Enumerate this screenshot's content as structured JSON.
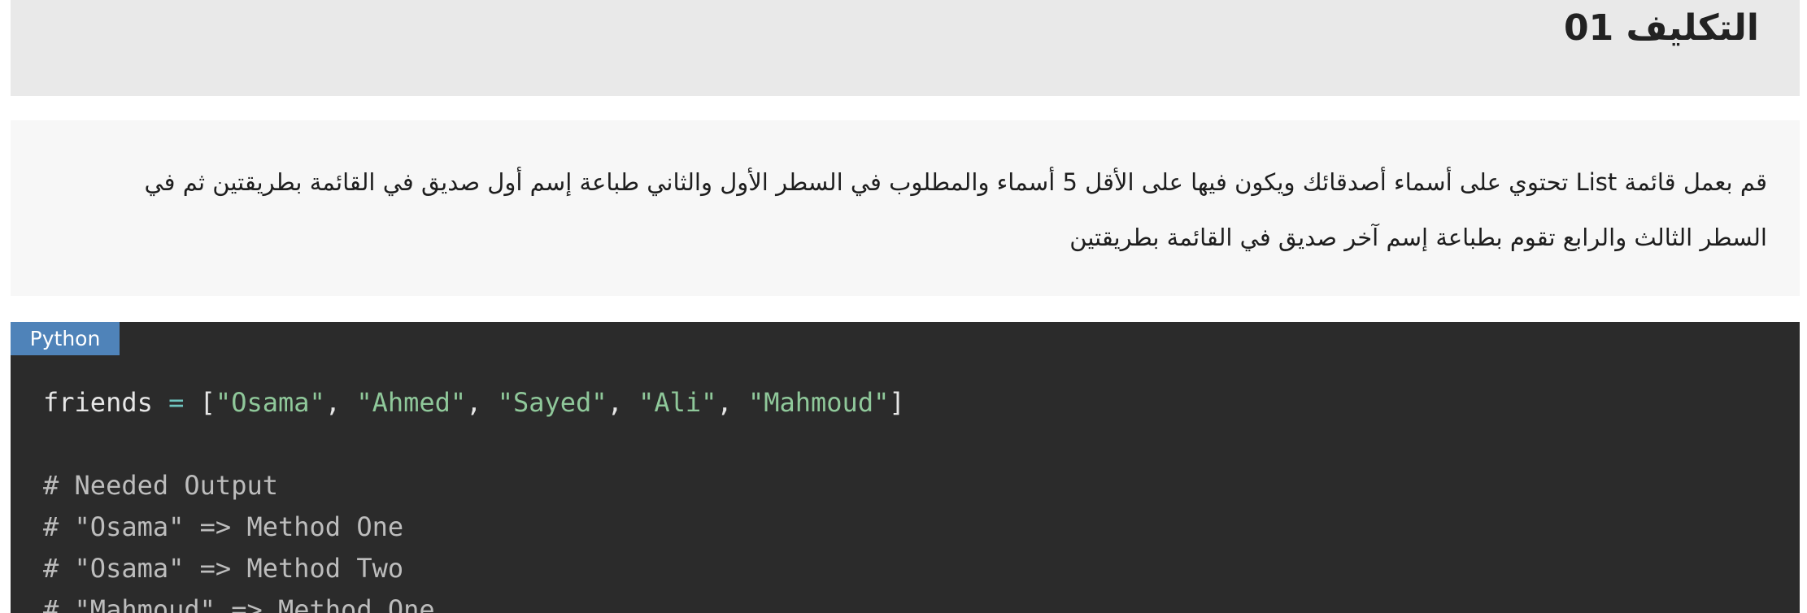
{
  "assignment": {
    "title": "التكليف 01",
    "description": "قم بعمل قائمة List تحتوي على أسماء أصدقائك ويكون فيها على الأقل 5 أسماء والمطلوب في السطر الأول والثاني طباعة إسم أول صديق في القائمة بطريقتين ثم في السطر الثالث والرابع تقوم بطباعة إسم آخر صديق في القائمة بطريقتين"
  },
  "code": {
    "language": "Python",
    "line1": {
      "var": "friends",
      "op": "=",
      "open": "[",
      "items": [
        "\"Osama\"",
        "\"Ahmed\"",
        "\"Sayed\"",
        "\"Ali\"",
        "\"Mahmoud\""
      ],
      "sep": ", ",
      "close": "]"
    },
    "comments": [
      "# Needed Output",
      "# \"Osama\" => Method One",
      "# \"Osama\" => Method Two",
      "# \"Mahmoud\" => Method One"
    ]
  },
  "colors": {
    "title_bg": "#e9e9e9",
    "desc_bg": "#f7f7f7",
    "code_bg": "#2b2b2b",
    "badge_bg": "#4f83b9",
    "string": "#8fc89a",
    "operator": "#6fc6c0",
    "comment": "#bdbdbd"
  }
}
